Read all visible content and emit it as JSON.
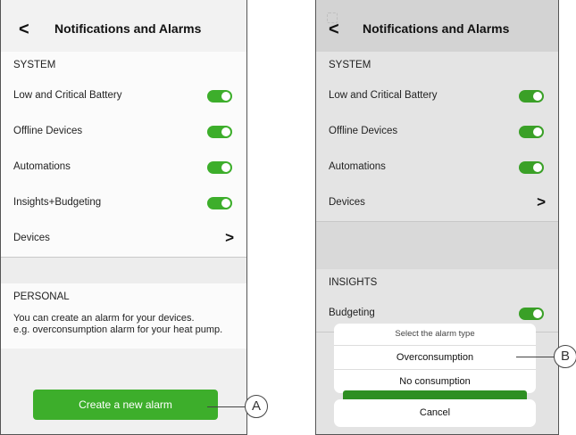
{
  "left_screen": {
    "header": {
      "back_icon": "chevron-left-icon",
      "title": "Notifications and Alarms"
    },
    "system_section": "SYSTEM",
    "toggles": [
      {
        "label": "Low and Critical Battery",
        "on": true
      },
      {
        "label": "Offline Devices",
        "on": true
      },
      {
        "label": "Automations",
        "on": true
      },
      {
        "label": "Insights+Budgeting",
        "on": true
      }
    ],
    "devices_row": "Devices",
    "personal_section": "PERSONAL",
    "description_line1": "You can create an alarm for your devices.",
    "description_line2": "e.g. overconsumption alarm for your heat pump.",
    "create_button": "Create a new alarm",
    "callout": "A"
  },
  "right_screen": {
    "header": {
      "back_icon": "chevron-left-icon",
      "title": "Notifications and Alarms"
    },
    "system_section": "SYSTEM",
    "toggles": [
      {
        "label": "Low and Critical Battery",
        "on": true
      },
      {
        "label": "Offline Devices",
        "on": true
      },
      {
        "label": "Automations",
        "on": true
      }
    ],
    "devices_row": "Devices",
    "insights_section": "INSIGHTS",
    "budgeting_row": "Budgeting",
    "sheet": {
      "title": "Select the alarm type",
      "options": [
        "Overconsumption",
        "No consumption"
      ],
      "cancel": "Cancel"
    },
    "callout": "B"
  },
  "colors": {
    "toggle_on": "#3dae2b",
    "button": "#3dae2b"
  }
}
